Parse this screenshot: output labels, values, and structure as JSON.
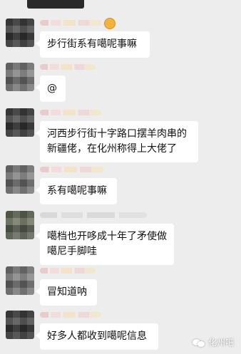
{
  "messages": [
    {
      "text": "步行街系有噶呢事嘛"
    },
    {
      "text": "@"
    },
    {
      "text": "河西步行街十字路口摆羊肉串的新疆佬，在化州称得上大佬了"
    },
    {
      "text": "系有噶呢事嘛"
    },
    {
      "text": "噶档也开哆成十年了矛使做噶尼手脚哇"
    },
    {
      "text": "冒知道呐"
    },
    {
      "text": "好多人都收到噶呢信息"
    }
  ],
  "watermark": {
    "label": "化州吧"
  },
  "colors": {
    "background": "#ededed",
    "bubble": "#ffffff"
  }
}
